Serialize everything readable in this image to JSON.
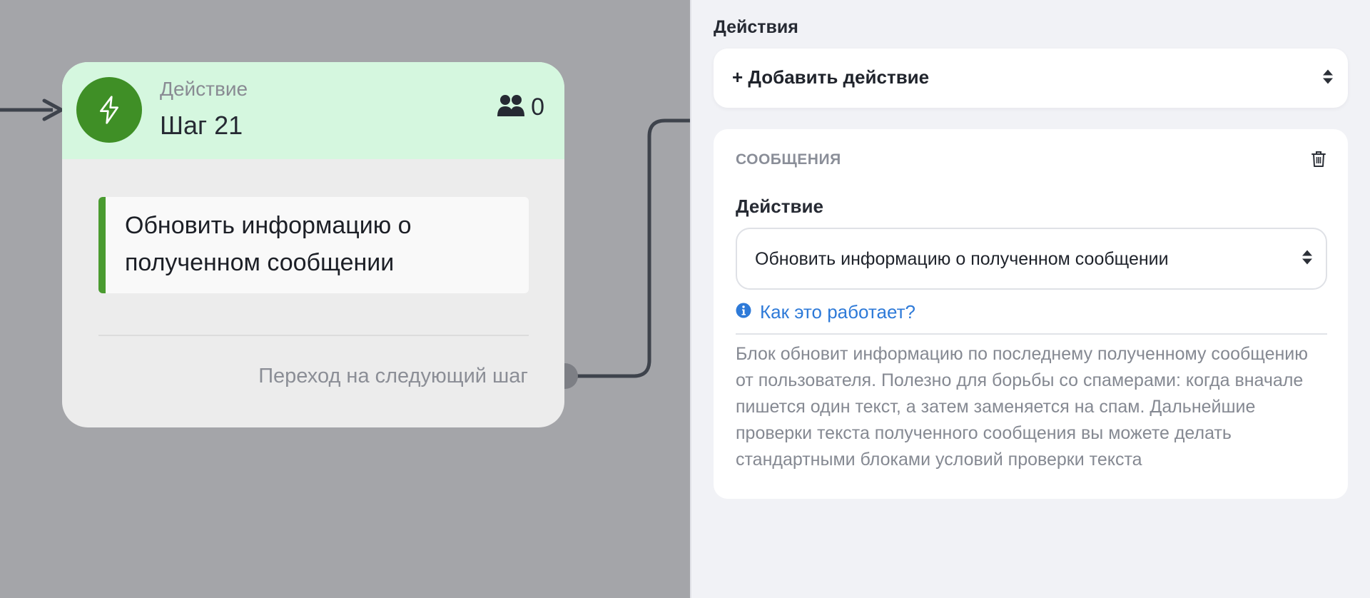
{
  "node": {
    "type_label": "Действие",
    "title": "Шаг 21",
    "users_count": "0",
    "action_text": "Обновить информацию о полученном сообщении",
    "next_step": "Переход на следующий шаг"
  },
  "panel": {
    "actions_label": "Действия",
    "add_action": "+ Добавить действие",
    "card": {
      "title": "СООБЩЕНИЯ",
      "field_label": "Действие",
      "field_value": "Обновить информацию о полученном сообщении",
      "how_link": "Как это работает?",
      "description": "Блок обновит информацию по последнему полученному сообщению от пользователя. Полезно для борьбы со спамерами: когда вначале пишется один текст, а затем заменяется на спам. Дальнейшие проверки текста полученного сообщения вы можете делать стандартными блоками условий проверки текста"
    }
  },
  "colors": {
    "canvas_bg": "#a4a5a9",
    "node_header_bg": "#d5f7df",
    "node_icon_bg": "#3f8f26",
    "action_bar": "#4a9b30",
    "link": "#2e7ad8"
  },
  "icons": {
    "node_icon": "lightning-icon",
    "users_icon": "users-icon",
    "select_icon": "sort-arrows-icon",
    "delete_icon": "trash-icon",
    "info_icon": "info-icon"
  }
}
